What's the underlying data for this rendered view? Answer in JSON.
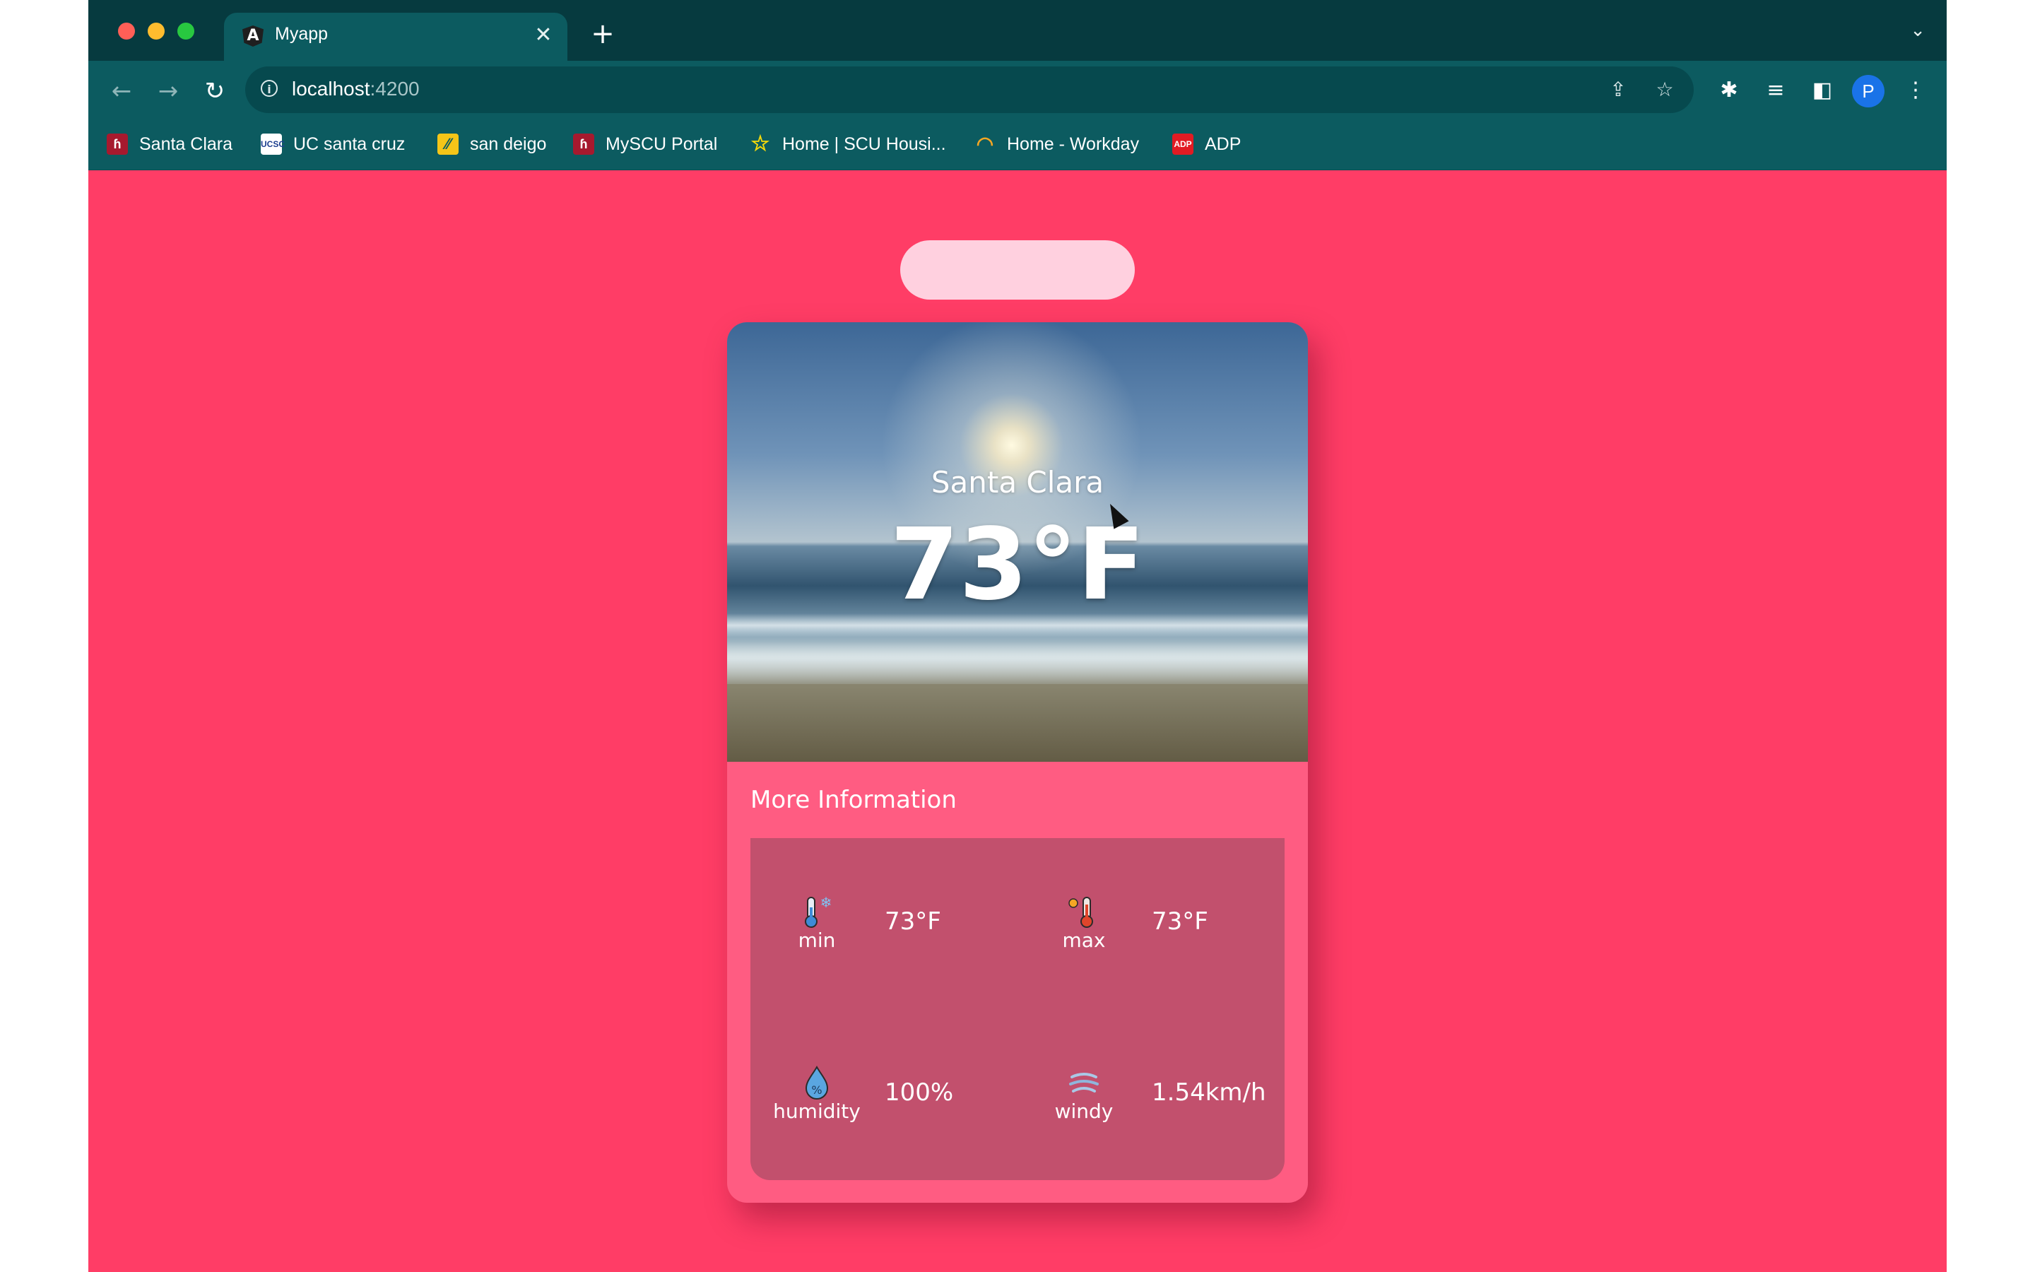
{
  "browser": {
    "tab_title": "Myapp",
    "tab_favicon": "A",
    "close_glyph": "✕",
    "new_tab_glyph": "+",
    "url_host": "localhost",
    "url_port": ":4200",
    "avatar_initial": "P"
  },
  "bookmarks": [
    {
      "label": "Santa Clara",
      "icon": "scu-logo-icon"
    },
    {
      "label": "UC santa cruz",
      "icon": "ucsc-logo-icon"
    },
    {
      "label": "san deigo",
      "icon": "sdsu-logo-icon"
    },
    {
      "label": "MySCU Portal",
      "icon": "scu-logo-icon"
    },
    {
      "label": "Home | SCU Housi...",
      "icon": "star-icon"
    },
    {
      "label": "Home - Workday",
      "icon": "workday-icon"
    },
    {
      "label": "ADP",
      "icon": "adp-logo-icon"
    }
  ],
  "search": {
    "placeholder": "",
    "value": ""
  },
  "weather": {
    "city": "Santa Clara",
    "temperature": "73°F",
    "more_info_title": "More Information",
    "stats": {
      "min": {
        "label": "min",
        "value": "73°F",
        "icon": "thermometer-cold-icon"
      },
      "max": {
        "label": "max",
        "value": "73°F",
        "icon": "thermometer-hot-icon"
      },
      "humidity": {
        "label": "humidity",
        "value": "100%",
        "icon": "humidity-drop-icon"
      },
      "wind": {
        "label": "windy",
        "value": "1.54km/h",
        "icon": "wind-icon"
      }
    }
  },
  "colors": {
    "page_background": "#ff3d66",
    "card_background": "#ff5c82",
    "info_panel": "#c2506d",
    "search_pill": "#ffd0df",
    "browser_chrome": "#0c5b60"
  }
}
